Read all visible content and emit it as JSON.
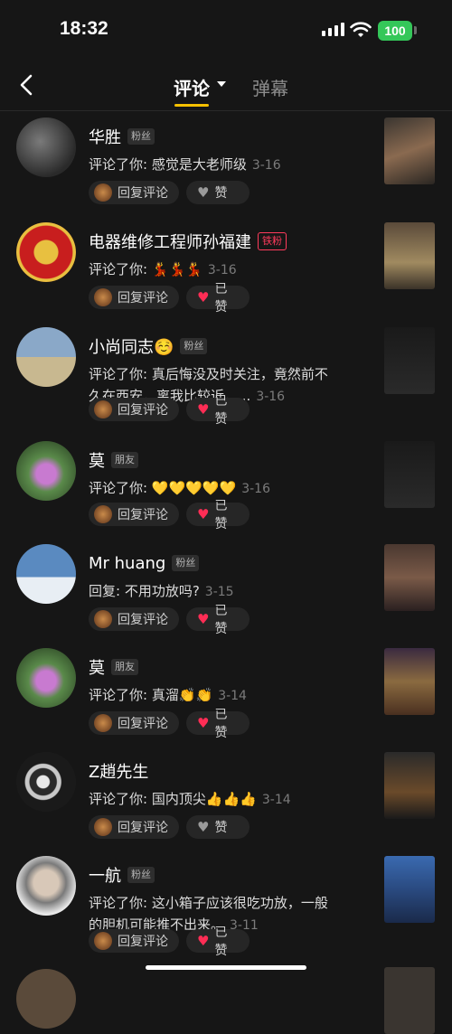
{
  "status": {
    "time": "18:32",
    "battery": "100"
  },
  "nav": {
    "back_icon": "chevron-left-icon",
    "tab_comments": "评论",
    "tab_danmu": "弹幕",
    "accent": "#f6c100"
  },
  "actions": {
    "reply": "回复评论",
    "like": "赞",
    "liked": "已赞"
  },
  "comments": [
    {
      "name": "华胜",
      "badge": "粉丝",
      "badge_type": "normal",
      "text": "评论了你: 感觉是大老师级",
      "date": "3-16",
      "liked": false
    },
    {
      "name": "电器维修工程师孙福建",
      "badge": "铁粉",
      "badge_type": "iron",
      "text": "评论了你: 💃💃💃",
      "date": "3-16",
      "liked": true
    },
    {
      "name": "小尚同志☺️",
      "badge": "粉丝",
      "badge_type": "normal",
      "text": "评论了你: 真后悔没及时关注，竟然前不久在西安，离我比较近，...",
      "date": "3-16",
      "liked": true
    },
    {
      "name": "莫",
      "badge": "朋友",
      "badge_type": "normal",
      "text": "评论了你: 💛💛💛💛💛",
      "date": "3-16",
      "liked": true
    },
    {
      "name": "Mr huang",
      "badge": "粉丝",
      "badge_type": "normal",
      "text": "回复: 不用功放吗?",
      "date": "3-15",
      "liked": true
    },
    {
      "name": "莫",
      "badge": "朋友",
      "badge_type": "normal",
      "text": "评论了你: 真溜👏👏",
      "date": "3-14",
      "liked": true
    },
    {
      "name": "Z趙先生",
      "badge": "",
      "badge_type": "none",
      "text": "评论了你: 国内顶尖👍👍👍",
      "date": "3-14",
      "liked": false
    },
    {
      "name": "一航",
      "badge": "粉丝",
      "badge_type": "normal",
      "text": "评论了你: 这小箱子应该很吃功放，一般的胆机可能推不出来。",
      "date": "3-11",
      "liked": true
    }
  ]
}
